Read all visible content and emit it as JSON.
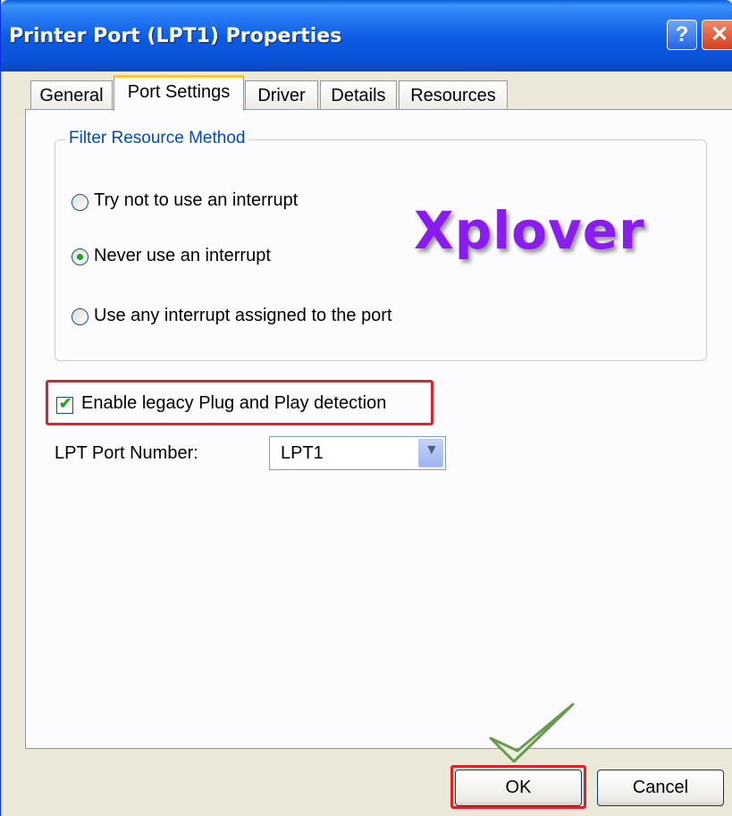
{
  "window": {
    "title": "Printer Port (LPT1) Properties",
    "help_glyph": "?",
    "close_glyph": "✕"
  },
  "tabs": [
    {
      "label": "General",
      "active": false
    },
    {
      "label": "Port Settings",
      "active": true
    },
    {
      "label": "Driver",
      "active": false
    },
    {
      "label": "Details",
      "active": false
    },
    {
      "label": "Resources",
      "active": false
    }
  ],
  "filter_group": {
    "label": "Filter Resource Method",
    "options": [
      {
        "label": "Try not to use an interrupt",
        "selected": false
      },
      {
        "label": "Never use an interrupt",
        "selected": true
      },
      {
        "label": "Use any interrupt assigned to the port",
        "selected": false
      }
    ]
  },
  "watermark": "Xplover",
  "legacy_pnp": {
    "label": "Enable legacy Plug and Play detection",
    "checked": true
  },
  "lpt_port": {
    "label": "LPT Port Number:",
    "value": "LPT1"
  },
  "buttons": {
    "ok": "OK",
    "cancel": "Cancel"
  },
  "colors": {
    "highlight": "#e2202a",
    "accent_tab": "#ffc83c",
    "title_bar": "#0c5ae3",
    "watermark": "#8a1cf0"
  }
}
